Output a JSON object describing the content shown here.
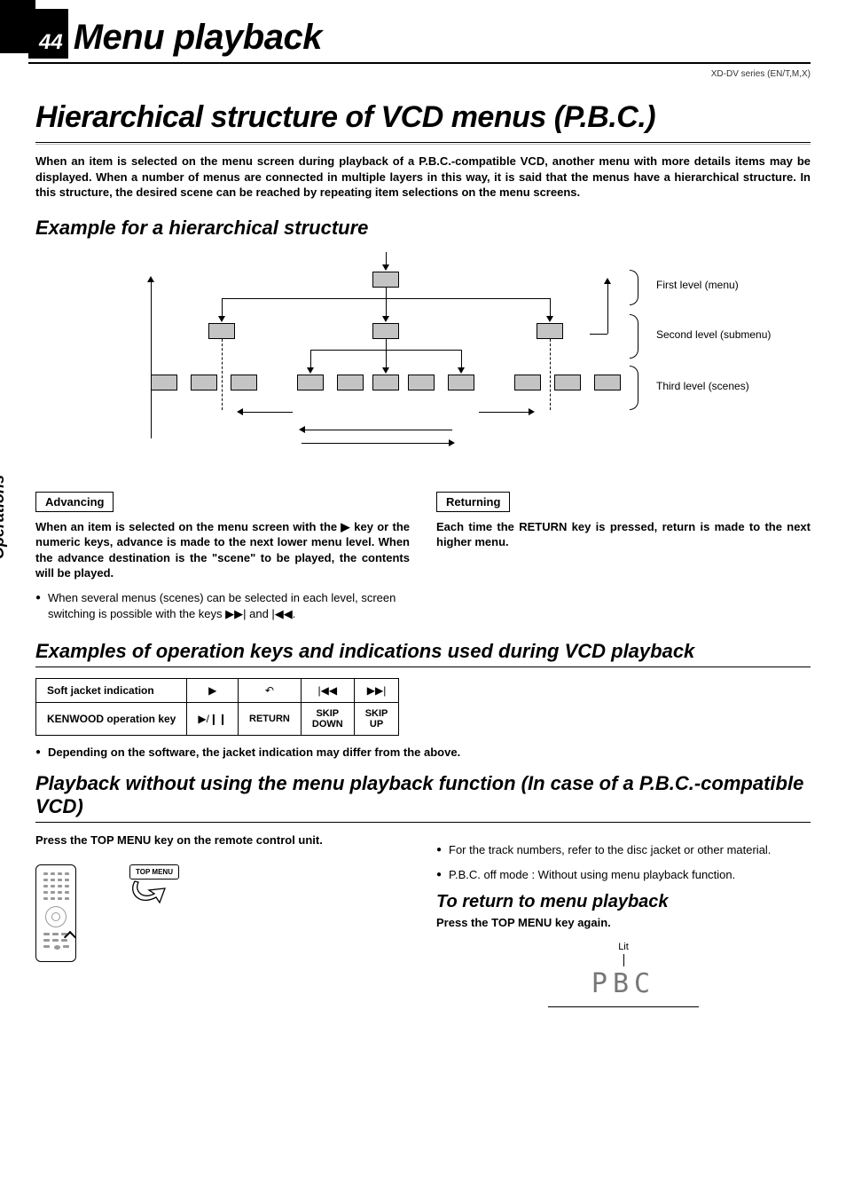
{
  "header": {
    "page_number": "44",
    "page_title": "Menu playback",
    "series": "XD-DV series (EN/T,M,X)"
  },
  "sidebar": "Operations",
  "section1": {
    "heading": "Hierarchical structure of VCD menus (P.B.C.)",
    "intro": "When an item is selected on the menu screen during playback of a P.B.C.-compatible VCD, another menu with more details items may be displayed. When a number of menus are connected in multiple layers in this way, it is said that the menus have a hierarchical structure. In this structure, the desired scene can be reached by repeating item selections on the menu screens.",
    "example_heading": "Example for a hierarchical structure",
    "levels": {
      "l1": "First level (menu)",
      "l2": "Second level (submenu)",
      "l3": "Third level (scenes)"
    },
    "advancing": {
      "label": "Advancing",
      "text": "When an item is selected on the menu screen with the ▶ key or the numeric keys, advance is made to the next lower menu level. When the advance destination is the \"scene\" to be played, the contents will be played.",
      "note": "When several menus (scenes) can be selected in each level, screen switching is possible with the keys ▶▶| and |◀◀."
    },
    "returning": {
      "label": "Returning",
      "text": "Each time the RETURN key is pressed, return is made to the next higher menu."
    }
  },
  "section2": {
    "heading": "Examples of operation keys and indications used during VCD playback",
    "table": {
      "row1_label": "Soft jacket indication",
      "row2_label": "KENWOOD operation key",
      "c1_top": "▶",
      "c2_top": "↶",
      "c3_top": "|◀◀",
      "c4_top": "▶▶|",
      "c1_bot": "▶/❙❙",
      "c2_bot": "RETURN",
      "c3_bot_l1": "SKIP",
      "c3_bot_l2": "DOWN",
      "c4_bot_l1": "SKIP",
      "c4_bot_l2": "UP"
    },
    "note": "Depending on the software, the jacket indication may differ from the above."
  },
  "section3": {
    "heading": "Playback without using the menu playback function (In case of a P.B.C.-compatible VCD)",
    "instr": "Press the TOP MENU key on the remote control unit.",
    "button_label": "TOP MENU",
    "rnote1": "For the track numbers, refer to the disc jacket or other material.",
    "rnote2": "P.B.C. off mode : Without using menu playback function.",
    "return_heading": "To return to menu playback",
    "return_instr": "Press the TOP MENU key again.",
    "display": {
      "lit": "Lit",
      "text": "PBC"
    }
  }
}
